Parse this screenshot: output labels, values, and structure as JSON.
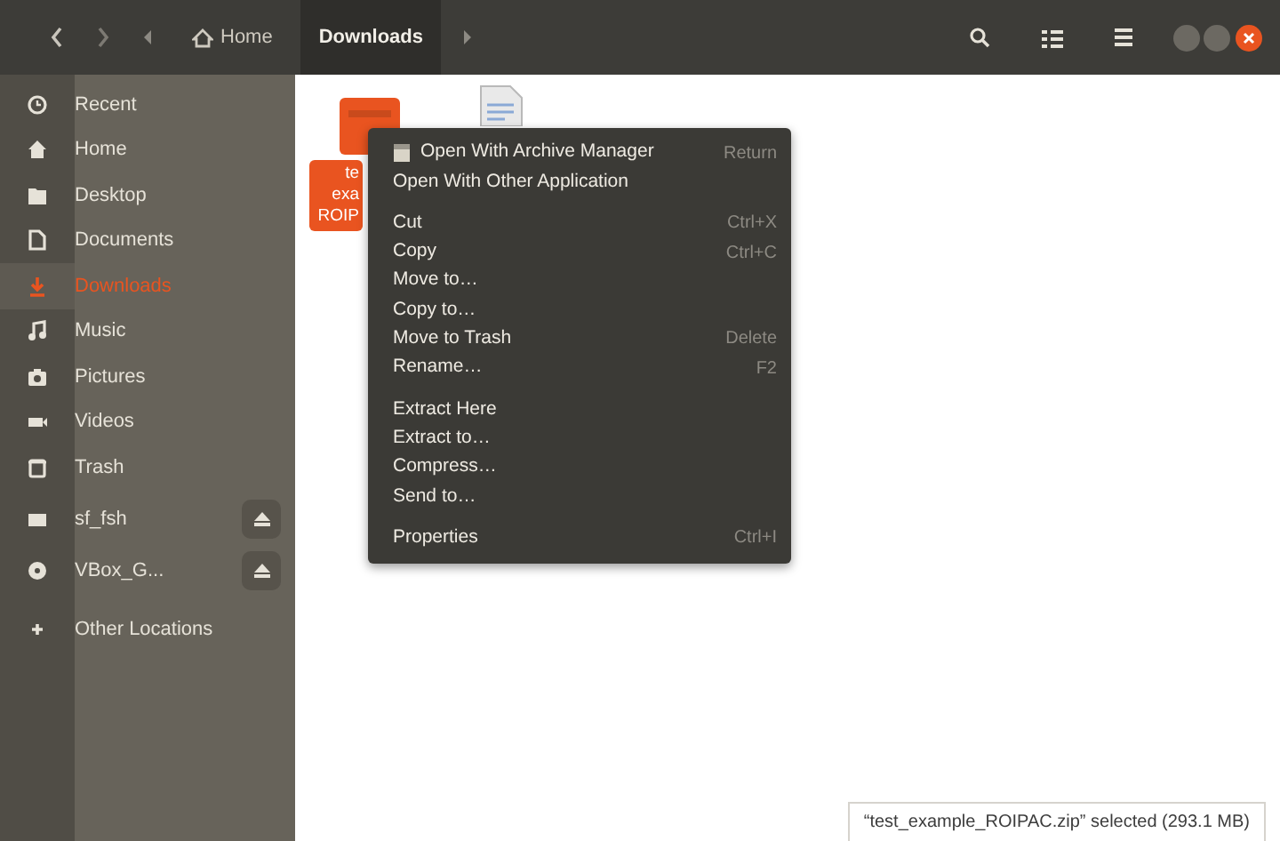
{
  "path_bar": {
    "crumbs": [
      {
        "label": "Home",
        "selected": false
      },
      {
        "label": "Downloads",
        "selected": true
      }
    ]
  },
  "sidebar": {
    "items": [
      {
        "label": "Recent",
        "selected": false,
        "ejectable": false
      },
      {
        "label": "Home",
        "selected": false,
        "ejectable": false
      },
      {
        "label": "Desktop",
        "selected": false,
        "ejectable": false
      },
      {
        "label": "Documents",
        "selected": false,
        "ejectable": false
      },
      {
        "label": "Downloads",
        "selected": true,
        "ejectable": false
      },
      {
        "label": "Music",
        "selected": false,
        "ejectable": false
      },
      {
        "label": "Pictures",
        "selected": false,
        "ejectable": false
      },
      {
        "label": "Videos",
        "selected": false,
        "ejectable": false
      },
      {
        "label": "Trash",
        "selected": false,
        "ejectable": false
      },
      {
        "label": "sf_fsh",
        "selected": false,
        "ejectable": true
      },
      {
        "label": "VBox_G...",
        "selected": false,
        "ejectable": true
      },
      {
        "label": "Other Locations",
        "selected": false,
        "ejectable": false
      }
    ]
  },
  "files": [
    {
      "kind": "archive",
      "selected": true,
      "label_lines": [
        "te",
        "exa",
        "ROIP"
      ]
    },
    {
      "kind": "document",
      "selected": false
    }
  ],
  "context_menu": {
    "groups": [
      [
        {
          "label": "Open With Archive Manager",
          "shortcut": "Return",
          "kind": "app"
        },
        {
          "label": "Open With Other Application",
          "kind": "text"
        }
      ],
      [
        {
          "label": "Cut",
          "shortcut": "Ctrl+X",
          "kind": "text"
        },
        {
          "label": "Copy",
          "shortcut": "Ctrl+C",
          "kind": "text"
        },
        {
          "label": "Move to…",
          "kind": "text"
        },
        {
          "label": "Copy to…",
          "kind": "text"
        },
        {
          "label": "Move to Trash",
          "shortcut": "Delete",
          "kind": "text"
        },
        {
          "label": "Rename…",
          "shortcut": "F2",
          "kind": "text"
        }
      ],
      [
        {
          "label": "Extract Here",
          "kind": "text"
        },
        {
          "label": "Extract to…",
          "kind": "text"
        },
        {
          "label": "Compress…",
          "kind": "text"
        },
        {
          "label": "Send to…",
          "kind": "text"
        }
      ],
      [
        {
          "label": "Properties",
          "shortcut": "Ctrl+I",
          "kind": "text"
        }
      ]
    ]
  },
  "status": "“test_example_ROIPAC.zip” selected (293.1 MB)"
}
